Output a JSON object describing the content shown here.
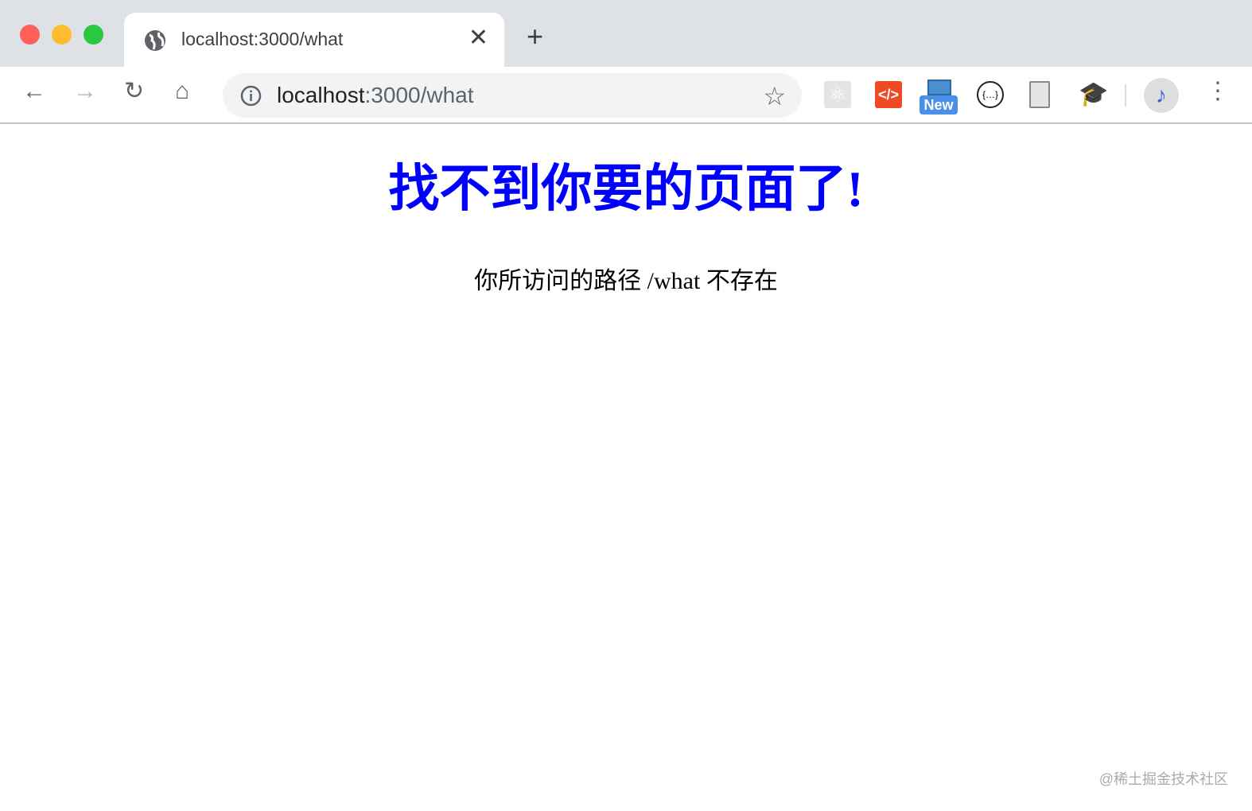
{
  "window": {
    "colors": {
      "close": "#ff5f57",
      "minimize": "#febc2e",
      "maximize": "#28c840"
    }
  },
  "tab": {
    "title": "localhost:3000/what",
    "icon": "globe-icon"
  },
  "address_bar": {
    "host": "localhost",
    "path": ":3000/what"
  },
  "extensions": [
    "react-devtools-icon",
    "code-icon",
    "new-badge-extension-icon",
    "json-icon",
    "document-icon",
    "graduation-cap-icon",
    "profile-avatar-music-icon"
  ],
  "extension_badge": "New",
  "page": {
    "heading": "找不到你要的页面了!",
    "message": "你所访问的路径 /what 不存在",
    "heading_color": "#0000ff"
  },
  "watermark": "@稀土掘金技术社区"
}
